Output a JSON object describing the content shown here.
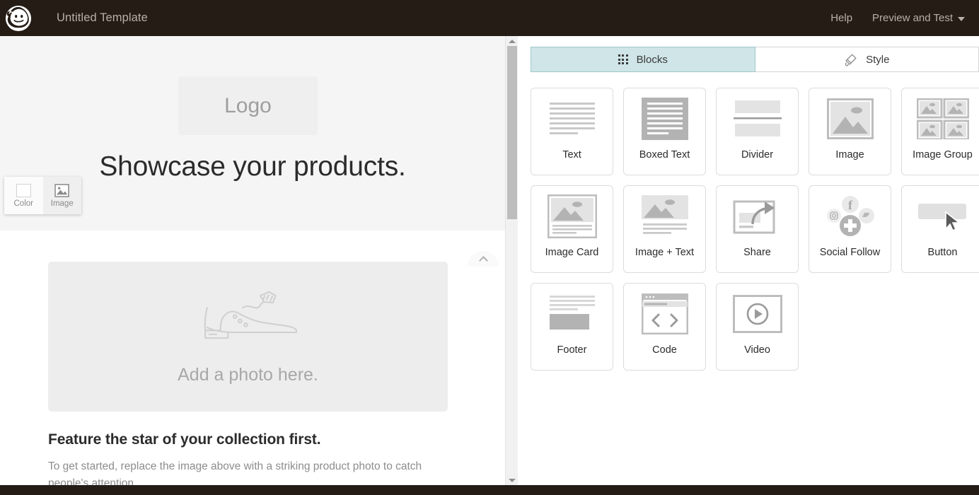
{
  "header": {
    "logo_icon": "mailchimp-freddie-logo",
    "title": "Untitled Template",
    "help_label": "Help",
    "preview_label": "Preview and Test",
    "caret_icon": "chevron-down-icon",
    "bg_color": "#241c15",
    "text_color": "#b9b0a6"
  },
  "canvas": {
    "logo_placeholder": "Logo",
    "hero_title": "Showcase your products.",
    "collapse_icon": "chevron-up-icon",
    "photo_placeholder_label": "Add a photo here.",
    "photo_icon": "shoe-illustration",
    "feature_heading": "Feature the star of your collection first.",
    "feature_body": "To get started, replace the image above with a striking product photo to catch people's attention.",
    "hero_bg": "#f5f5f5",
    "drop_bg": "#ededed"
  },
  "bg_toolbar": {
    "color_label": "Color",
    "color_icon": "color-swatch-icon",
    "image_label": "Image",
    "image_icon": "image-icon"
  },
  "scrollbar": {
    "up_icon": "scroll-up-arrow-icon",
    "down_icon": "scroll-down-arrow-icon"
  },
  "right_panel": {
    "tabs": [
      {
        "label": "Blocks",
        "icon": "grid-dots-icon",
        "active": true
      },
      {
        "label": "Style",
        "icon": "paint-brush-icon",
        "active": false
      }
    ],
    "active_tab_color": "#cfe5e7",
    "blocks": [
      {
        "label": "Text",
        "icon": "text-lines-icon"
      },
      {
        "label": "Boxed Text",
        "icon": "boxed-text-icon"
      },
      {
        "label": "Divider",
        "icon": "divider-icon"
      },
      {
        "label": "Image",
        "icon": "image-icon"
      },
      {
        "label": "Image Group",
        "icon": "image-group-icon"
      },
      {
        "label": "Image Card",
        "icon": "image-card-icon"
      },
      {
        "label": "Image + Text",
        "icon": "image-text-icon"
      },
      {
        "label": "Share",
        "icon": "share-arrow-icon"
      },
      {
        "label": "Social Follow",
        "icon": "social-follow-icon"
      },
      {
        "label": "Button",
        "icon": "button-cursor-icon"
      },
      {
        "label": "Footer",
        "icon": "footer-icon"
      },
      {
        "label": "Code",
        "icon": "code-brackets-icon"
      },
      {
        "label": "Video",
        "icon": "video-play-icon"
      }
    ]
  }
}
